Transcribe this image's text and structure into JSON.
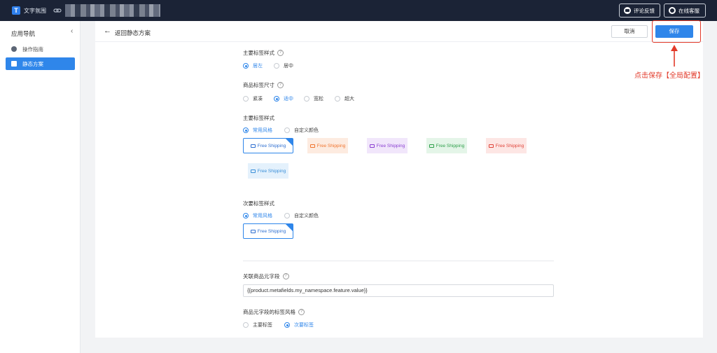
{
  "topbar": {
    "app_name": "文字氛围",
    "logo_letter": "T",
    "feedback_label": "评论反馈",
    "support_label": "在线客服"
  },
  "sidebar": {
    "title": "应用导航",
    "collapse_glyph": "‹",
    "items": [
      {
        "label": "操作指南",
        "icon": "info-circle-icon"
      },
      {
        "label": "静态方案",
        "icon": "document-icon"
      }
    ]
  },
  "header": {
    "back_glyph": "←",
    "back_label": "返回静态方案",
    "cancel_label": "取消",
    "save_label": "保存"
  },
  "form": {
    "help_glyph": "?",
    "primary_position": {
      "label": "主要标签样式",
      "options": [
        "居左",
        "居中"
      ],
      "selected": "居左"
    },
    "size": {
      "label": "商品标签尺寸",
      "options": [
        "紧凑",
        "适中",
        "宽松",
        "超大"
      ],
      "selected": "适中"
    },
    "primary_style": {
      "label": "主要标签样式",
      "options": [
        "常用风格",
        "自定义颜色"
      ],
      "selected": "常用风格",
      "swatches": [
        {
          "text": "Free Shipping",
          "color": "#2f6fd0",
          "selected": true
        },
        {
          "text": "Free Shipping",
          "color": "#f0742e",
          "bg": "#fdebe0"
        },
        {
          "text": "Free Shipping",
          "color": "#8a3fd1",
          "bg": "#f1e6fb"
        },
        {
          "text": "Free Shipping",
          "color": "#2e9e4a",
          "bg": "#e4f5e8"
        },
        {
          "text": "Free Shipping",
          "color": "#e0453b",
          "bg": "#fde6e4"
        },
        {
          "text": "Free Shipping",
          "color": "#2f86ea",
          "bg": "#e4f1fc"
        }
      ]
    },
    "secondary_style": {
      "label": "次要标签样式",
      "options": [
        "常用风格",
        "自定义颜色"
      ],
      "selected": "常用风格",
      "swatch": {
        "text": "Free Shipping",
        "color": "#2f6fd0"
      }
    },
    "metafield": {
      "label": "关联商品元字段",
      "value": "{{product.metafields.my_namespace.feature.value}}"
    },
    "metafield_style": {
      "label": "商品元字段的标签风格",
      "options": [
        "主要标签",
        "次要标签"
      ],
      "selected": "次要标签"
    }
  },
  "annotation": {
    "text": "点击保存【全局配置】",
    "color": "#e23a2a"
  }
}
